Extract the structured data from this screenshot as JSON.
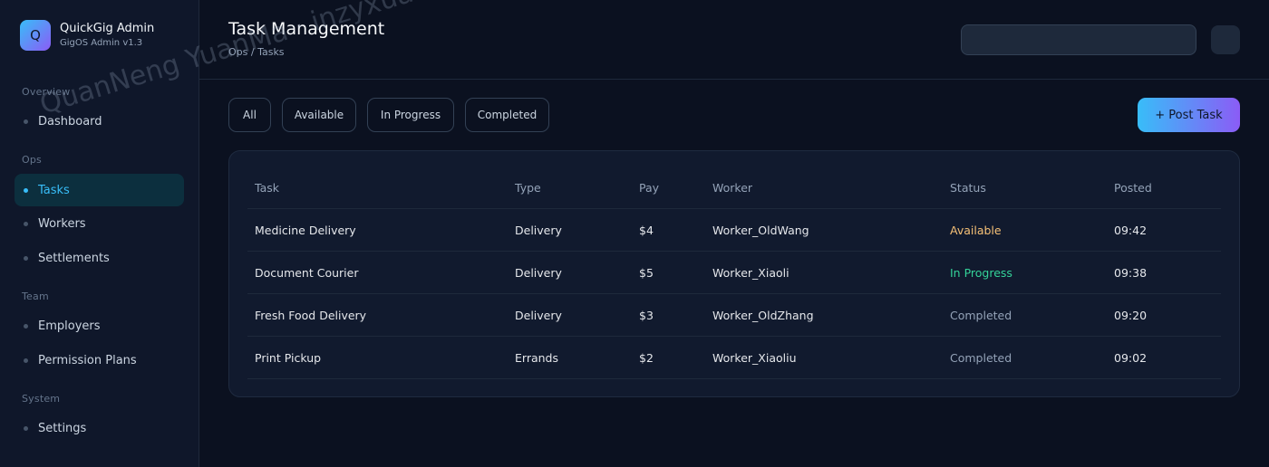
{
  "brand": {
    "logo_letter": "Q",
    "name": "QuickGig Admin",
    "version": "GigOS Admin v1.3"
  },
  "sidebar": {
    "sections": [
      {
        "label": "Overview",
        "items": [
          {
            "label": "Dashboard"
          }
        ]
      },
      {
        "label": "Ops",
        "items": [
          {
            "label": "Tasks",
            "active": true
          },
          {
            "label": "Workers"
          },
          {
            "label": "Settlements"
          }
        ]
      },
      {
        "label": "Team",
        "items": [
          {
            "label": "Employers"
          },
          {
            "label": "Permission Plans"
          }
        ]
      },
      {
        "label": "System",
        "items": [
          {
            "label": "Settings"
          }
        ]
      }
    ]
  },
  "header": {
    "title": "Task Management",
    "breadcrumb": "Ops / Tasks",
    "search": {
      "value": "",
      "placeholder": ""
    }
  },
  "filters": [
    "All",
    "Available",
    "In Progress",
    "Completed"
  ],
  "post_task_label": "+ Post Task",
  "table": {
    "columns": [
      "Task",
      "Type",
      "Pay",
      "Worker",
      "Status",
      "Posted"
    ],
    "rows": [
      {
        "task": "Medicine Delivery",
        "type": "Delivery",
        "pay": "$4",
        "worker": "Worker_OldWang",
        "status": "Available",
        "posted": "09:42"
      },
      {
        "task": "Document Courier",
        "type": "Delivery",
        "pay": "$5",
        "worker": "Worker_Xiaoli",
        "status": "In Progress",
        "posted": "09:38"
      },
      {
        "task": "Fresh Food Delivery",
        "type": "Delivery",
        "pay": "$3",
        "worker": "Worker_OldZhang",
        "status": "Completed",
        "posted": "09:20"
      },
      {
        "task": "Print Pickup",
        "type": "Errands",
        "pay": "$2",
        "worker": "Worker_Xiaoliu",
        "status": "Completed",
        "posted": "09:02"
      }
    ]
  },
  "status_colors": {
    "Available": "#f6c177",
    "In Progress": "#34d399",
    "Completed": "#94a3b8"
  },
  "colors": {
    "accent": "#38bdf8",
    "accent_2": "#8b5cf6",
    "background": "#0b1120",
    "sidebar": "#0f172a"
  },
  "watermark": "QuanNeng YuanMa · inzyxuashop.com"
}
